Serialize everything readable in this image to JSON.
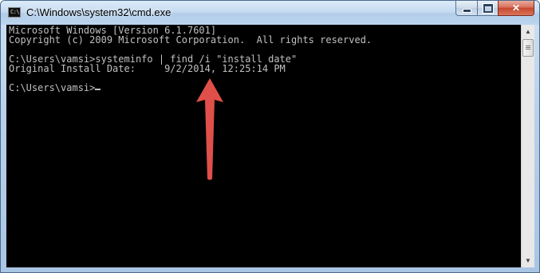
{
  "window": {
    "title": "C:\\Windows\\system32\\cmd.exe",
    "icon": "cmd-icon",
    "icon_text": "C:\\",
    "buttons": {
      "minimize": "minimize-icon",
      "maximize": "maximize-icon",
      "close": "✕"
    }
  },
  "console": {
    "lines": [
      "Microsoft Windows [Version 6.1.7601]",
      "Copyright (c) 2009 Microsoft Corporation.  All rights reserved.",
      "",
      "C:\\Users\\vamsi>systeminfo | find /i \"install date\"",
      "Original Install Date:     9/2/2014, 12:25:14 PM",
      "",
      "C:\\Users\\vamsi>"
    ],
    "text_color": "#c0c0c0",
    "background": "#000000"
  },
  "annotation": {
    "icon": "red-arrow-up",
    "color": "#e0504a"
  },
  "scrollbar": {
    "up_icon": "▲",
    "down_icon": "▼"
  }
}
